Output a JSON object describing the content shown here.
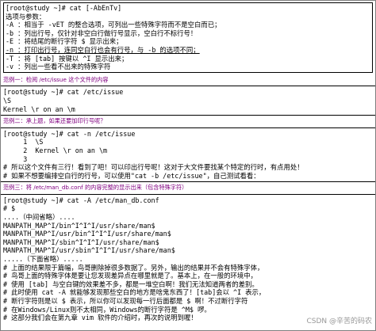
{
  "block1": {
    "lines": [
      "[root@study ~]# cat [-AbEnTv]",
      "选项与参数：",
      "-A ：相当于 -vET 的整合选项，可列出一些特殊字符而不是空白而已；",
      "-b ：列出行号，仅针对非空白行做行号显示，空白行不标行号！",
      "-E ：将结尾的断行字符 $ 显示出来；",
      "-n ：打印出行号，连同空白行也会有行号，与 -b 的选项不同；",
      "-T ：将 [tab] 按键以 ^I 显示出来；",
      "-v ：列出一些看不出来的特殊字符"
    ]
  },
  "example1": {
    "note": "范例一：检阅 /etc/issue 这个文件的内容",
    "lines": [
      "[root@study ~]# cat /etc/issue",
      "\\S",
      "Kernel \\r on an \\m"
    ]
  },
  "example2": {
    "note": "范例二：承上题，如果还要加印行号呢？",
    "lines": [
      "[root@study ~]# cat -n /etc/issue",
      "     1  \\S",
      "     2  Kernel \\r on an \\m",
      "     3",
      "# 所以这个文件有三行！看到了吧！可以印出行号呢！这对于大文件要找某个特定的行时，有点用处！",
      "# 如果不想要编排空白行的行号，可以使用\"cat -b /etc/issue\"，自己测试看看："
    ]
  },
  "example3": {
    "note": "范例三：将 /etc/man_db.conf 的内容完整的显示出来（包含特殊字符）",
    "lines": [
      "[root@study ~]# cat -A /etc/man_db.conf",
      "# $",
      "....（中间省略）....",
      "MANPATH_MAP^I/bin^I^I^I/usr/share/man$",
      "MANPATH_MAP^I/usr/bin^I^I^I/usr/share/man$",
      "MANPATH_MAP^I/sbin^I^I^I/usr/share/man$",
      "MANPATH_MAP^I/usr/sbin^I^I^I/usr/share/man$",
      ".....（下面省略）.....",
      "# 上面的结果限于篇幅，鸟哥删除掉很多数据了。另外，输出的结果并不会有特殊字体，",
      "# 鸟哥上面的特殊字体是要让您发现差异点在哪里就是了。基本上，在一般的环境中，",
      "# 使用 [tab] 与空白键的效果差不多，都是一堆空白啊！我们无法知道两者的差别。",
      "# 此时使用 cat -A 就能够发现那些空白的地方是啥鬼东西了！[tab]会以 ^I 表示，",
      "# 断行字符则是以 $ 表示，所以你可以发现每一行后面都是 $ 啊！不过断行字符",
      "# 在Windows/Linux则不太相同，Windows的断行字符是 ^M$ 啰。",
      "# 这部分我们会在第九章 vim 软件的介绍时，再次的说明到喔！"
    ]
  },
  "watermark": "CSDN @辛苦的码农"
}
